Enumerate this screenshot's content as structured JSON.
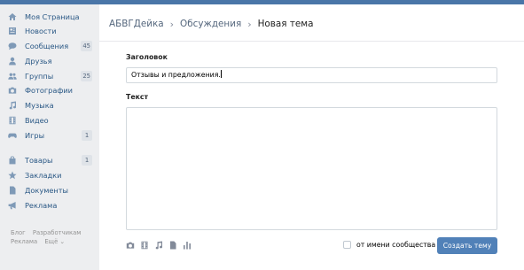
{
  "sidebar": {
    "items": [
      {
        "label": "Моя Страница",
        "icon": "home-icon"
      },
      {
        "label": "Новости",
        "icon": "news-icon"
      },
      {
        "label": "Сообщения",
        "icon": "messages-icon",
        "badge": "45"
      },
      {
        "label": "Друзья",
        "icon": "friends-icon"
      },
      {
        "label": "Группы",
        "icon": "groups-icon",
        "badge": "25"
      },
      {
        "label": "Фотографии",
        "icon": "camera-icon"
      },
      {
        "label": "Музыка",
        "icon": "music-icon"
      },
      {
        "label": "Видео",
        "icon": "video-icon"
      },
      {
        "label": "Игры",
        "icon": "games-icon",
        "badge": "1"
      },
      {
        "label": "Товары",
        "icon": "shopping-bag-icon",
        "badge": "1"
      },
      {
        "label": "Закладки",
        "icon": "star-icon"
      },
      {
        "label": "Документы",
        "icon": "document-icon"
      },
      {
        "label": "Реклама",
        "icon": "megaphone-icon"
      }
    ],
    "footer": {
      "blog": "Блог",
      "developers": "Разработчикам",
      "ads": "Реклама",
      "more": "Ещё ⌄"
    }
  },
  "breadcrumb": {
    "group": "АБВГДейка",
    "section": "Обсуждения",
    "current": "Новая тема",
    "separator": "›"
  },
  "form": {
    "title_label": "Заголовок",
    "title_value": "Отзывы и предложения.",
    "text_label": "Текст",
    "text_value": "",
    "community_checkbox_label": "от имени сообщества",
    "community_checked": false,
    "submit_label": "Создать тему",
    "attach_tools": [
      "camera-icon",
      "video-icon",
      "music-icon",
      "document-icon",
      "poll-icon"
    ]
  },
  "colors": {
    "accent": "#5181b8",
    "link": "#2a5885",
    "background": "#edeef0"
  }
}
